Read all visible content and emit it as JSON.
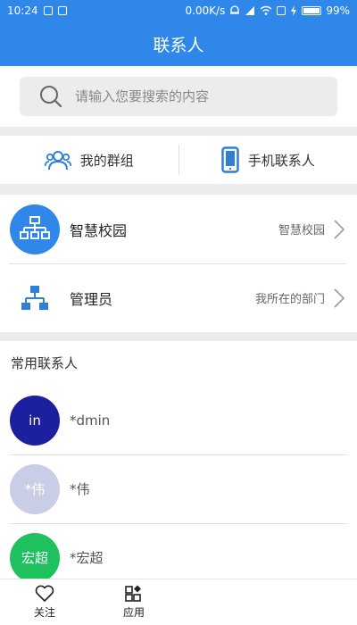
{
  "status_bar": {
    "time": "10:24",
    "network_speed": "0.00K/s",
    "battery": "99%"
  },
  "header": {
    "title": "联系人"
  },
  "search": {
    "placeholder": "请输入您要搜索的内容"
  },
  "tabs": [
    {
      "label": "我的群组",
      "icon": "group-icon"
    },
    {
      "label": "手机联系人",
      "icon": "phone-icon"
    }
  ],
  "org": [
    {
      "title": "智慧校园",
      "subtitle": "智慧校园",
      "icon": "org-chart-icon"
    },
    {
      "title": "管理员",
      "subtitle": "我所在的部门",
      "icon": "department-icon"
    }
  ],
  "contacts": {
    "section_title": "常用联系人",
    "items": [
      {
        "avatar_text": "in",
        "name": "*dmin",
        "avatar_color": "#1c1f9e"
      },
      {
        "avatar_text": "*伟",
        "name": "*伟",
        "avatar_color": "#c9cde6"
      },
      {
        "avatar_text": "宏超",
        "name": "*宏超",
        "avatar_color": "#1fc15e"
      }
    ]
  },
  "bottom_nav": [
    {
      "label": "关注",
      "icon": "heart-icon"
    },
    {
      "label": "应用",
      "icon": "apps-icon"
    }
  ],
  "colors": {
    "accent": "#2f88e9",
    "icon_blue": "#2f7fd6"
  }
}
